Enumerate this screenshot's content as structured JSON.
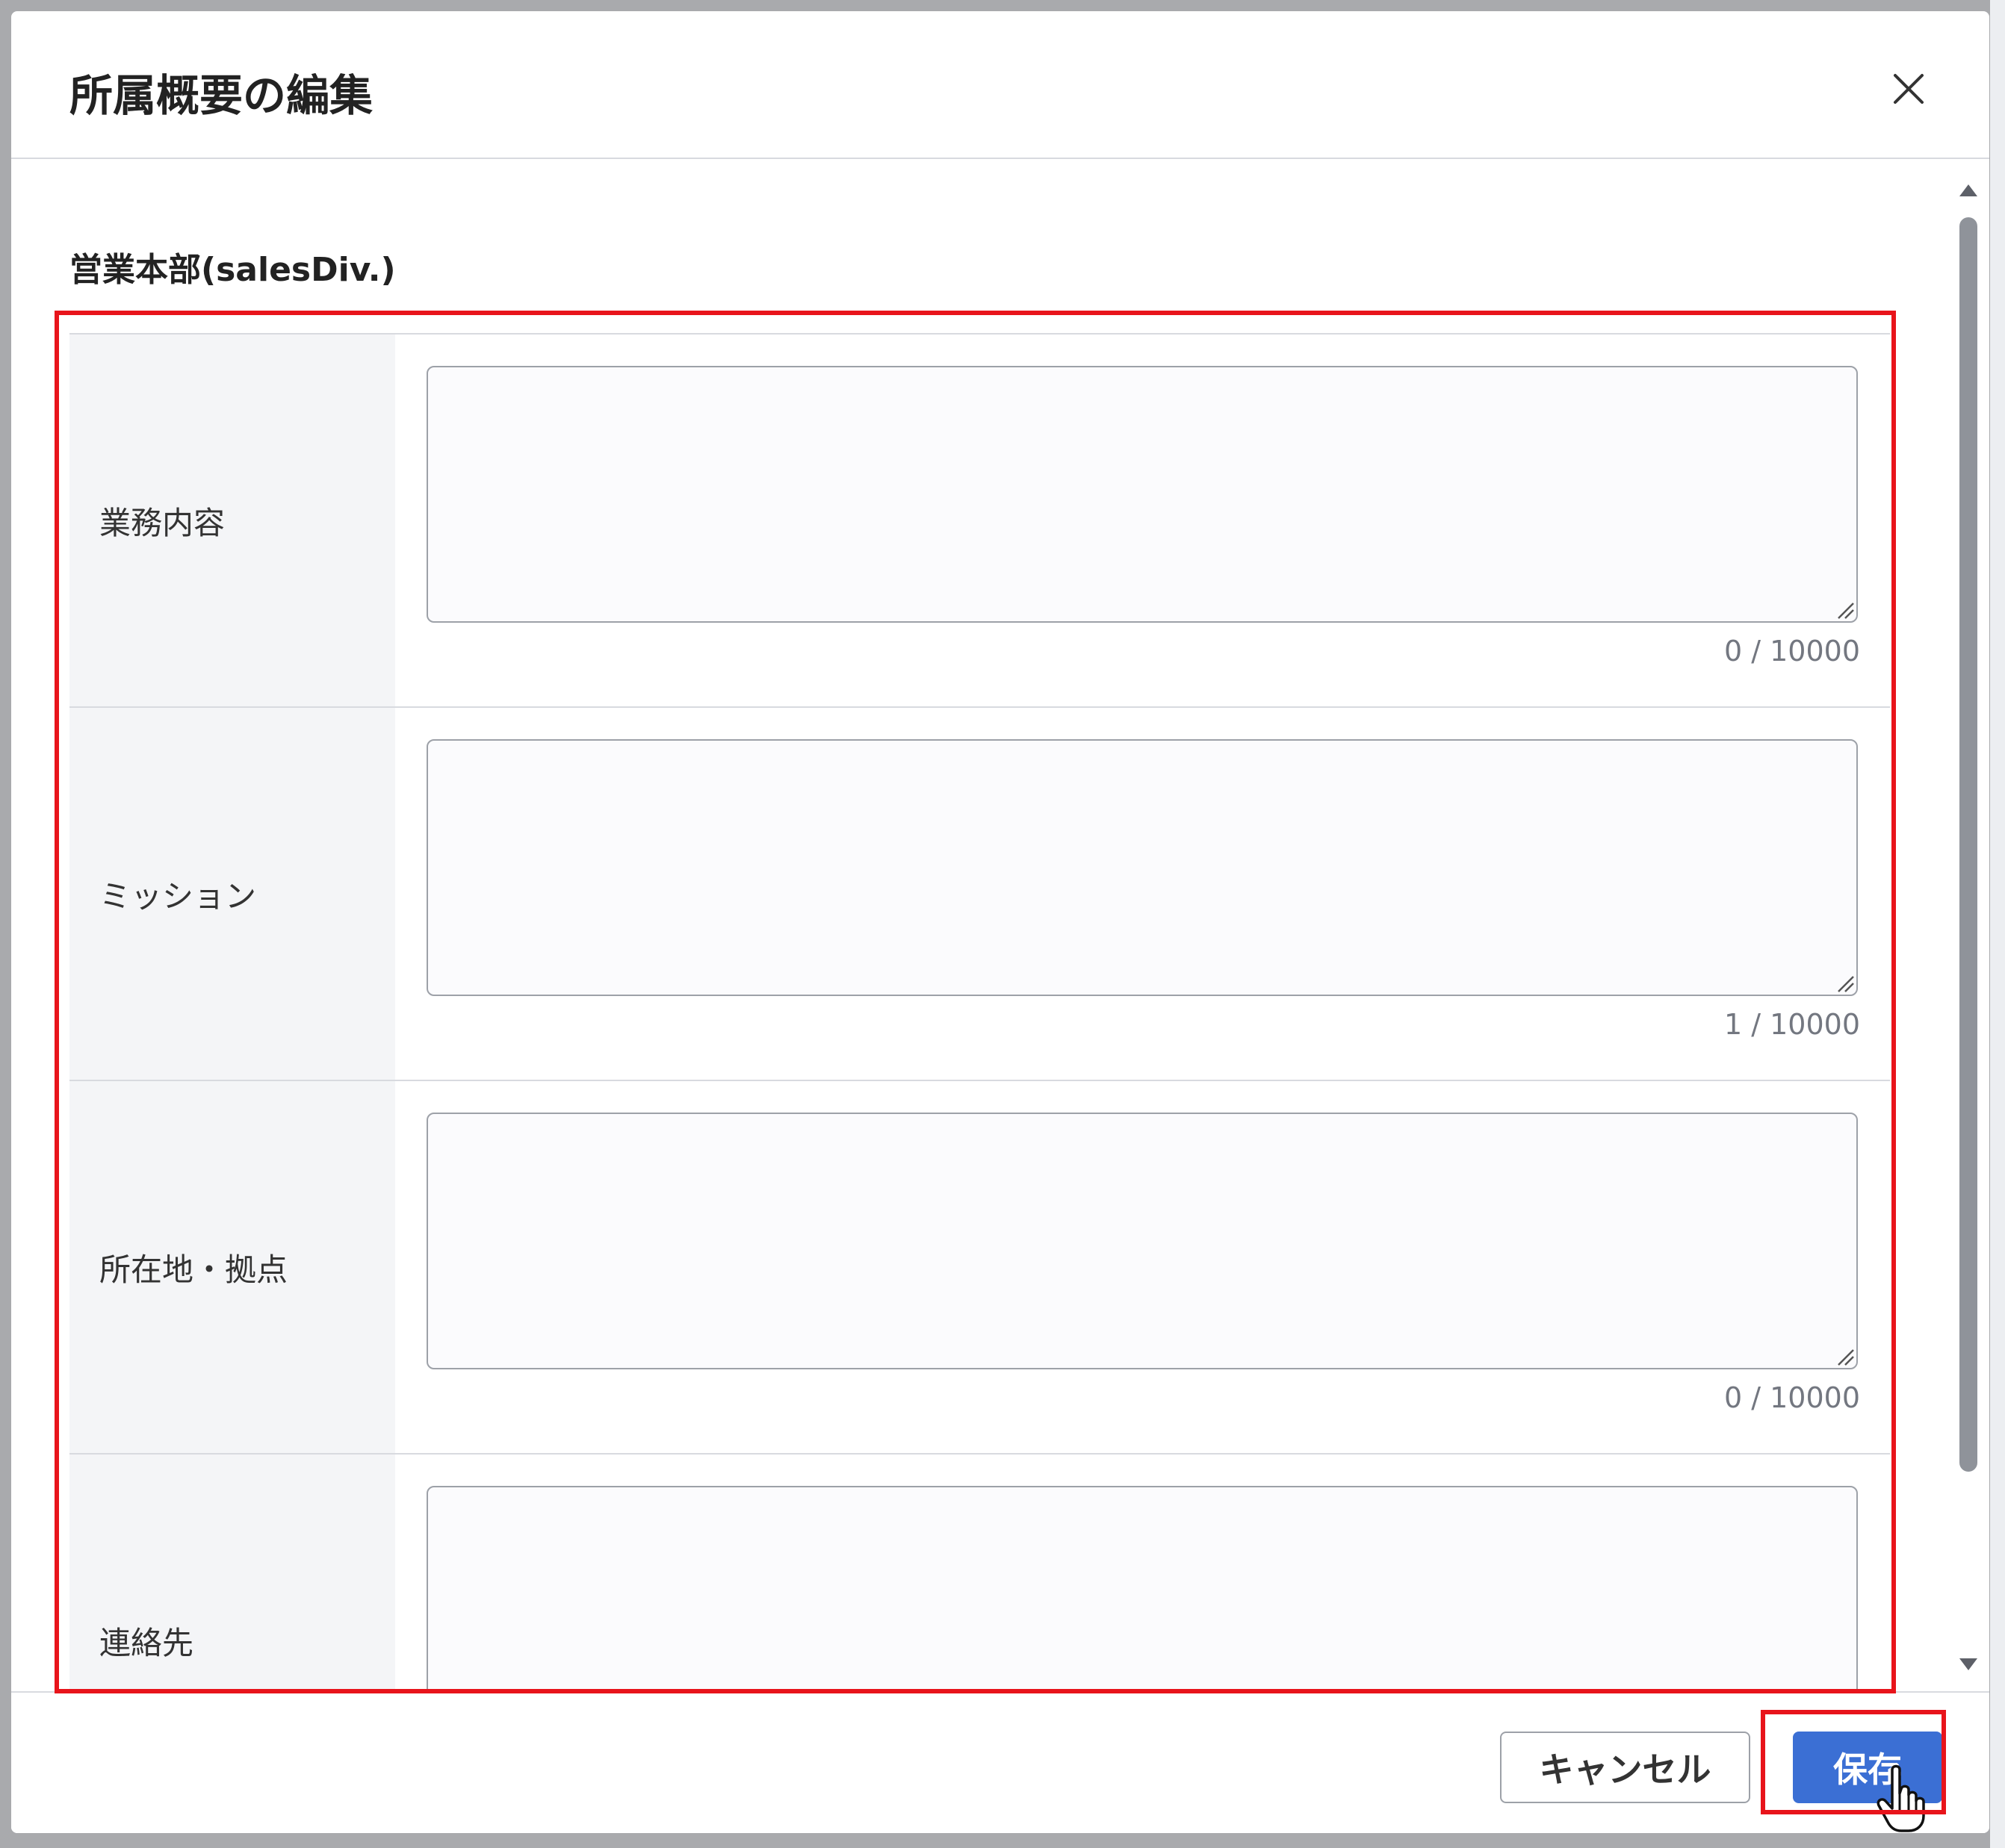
{
  "modal": {
    "title": "所属概要の編集",
    "close_icon": "close-icon"
  },
  "section": {
    "title": "営業本部(salesDiv.)"
  },
  "fields": [
    {
      "label": "業務内容",
      "value": "",
      "counter": "0 / 10000"
    },
    {
      "label": "ミッション",
      "value": "",
      "counter": "1 / 10000"
    },
    {
      "label": "所在地・拠点",
      "value": "",
      "counter": "0 / 10000"
    },
    {
      "label": "連絡先",
      "value": "",
      "counter": ""
    }
  ],
  "footer": {
    "cancel_label": "キャンセル",
    "save_label": "保存"
  },
  "colors": {
    "primary": "#3b6fd4",
    "highlight": "#e8141b",
    "label_bg": "#f4f5f7"
  }
}
